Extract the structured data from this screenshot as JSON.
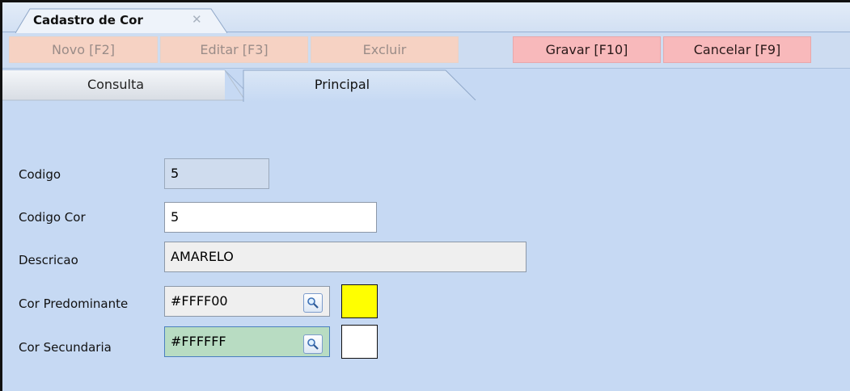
{
  "doc_tab": {
    "title": "Cadastro de Cor",
    "close_glyph": "✕"
  },
  "toolbar": {
    "novo": "Novo [F2]",
    "editar": "Editar [F3]",
    "excluir": "Excluir",
    "gravar": "Gravar [F10]",
    "cancelar": "Cancelar [F9]"
  },
  "tabs": {
    "consulta": "Consulta",
    "principal": "Principal"
  },
  "form": {
    "codigo": {
      "label": "Codigo",
      "value": "5"
    },
    "codigo_cor": {
      "label": "Codigo Cor",
      "value": "5"
    },
    "descricao": {
      "label": "Descricao",
      "value": "AMARELO"
    },
    "cor_predominante": {
      "label": "Cor Predominante",
      "value": "#FFFF00",
      "swatch_color": "#FFFF00"
    },
    "cor_secundaria": {
      "label": "Cor Secundaria",
      "value": "#FFFFFF",
      "swatch_color": "#FFFFFF"
    }
  },
  "icons": {
    "lookup": "magnifier-icon",
    "close": "close-icon"
  },
  "colors": {
    "background": "#C6D9F3",
    "disabled_button": "#F6D2C3",
    "active_button": "#F8B9BB",
    "focused_field": "#B8DCC2"
  }
}
